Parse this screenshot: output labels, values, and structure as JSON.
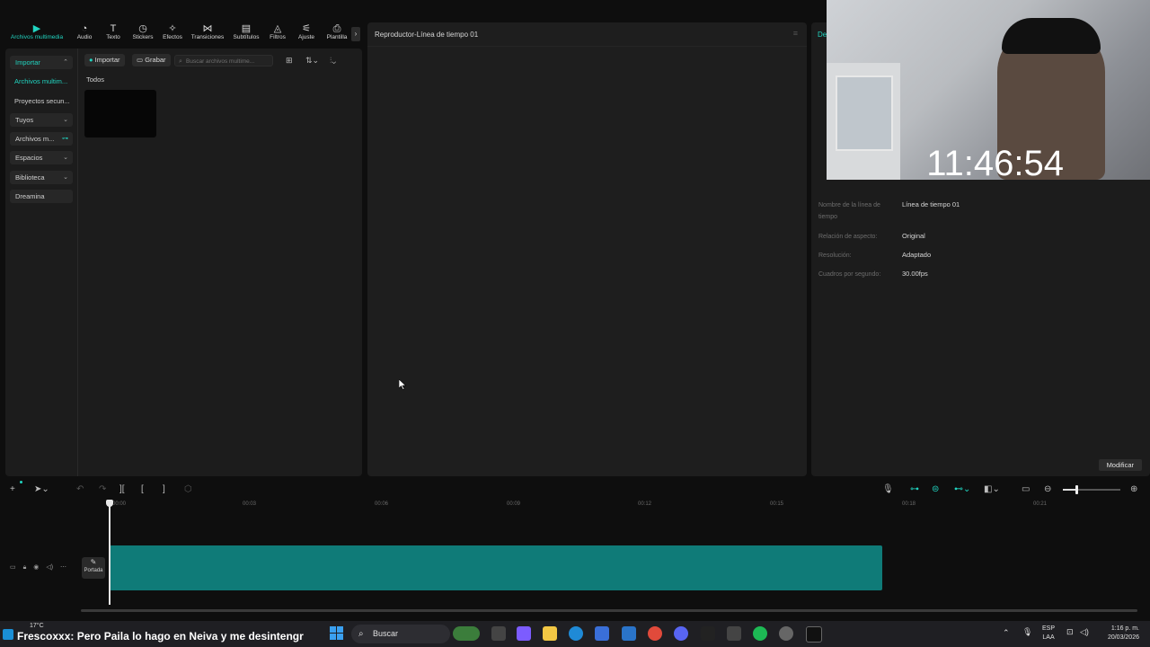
{
  "toolbar": {
    "items": [
      {
        "label": "Archivos multimedia",
        "icon": "media-icon",
        "active": true
      },
      {
        "label": "Audio",
        "icon": "audio-icon"
      },
      {
        "label": "Texto",
        "icon": "text-icon"
      },
      {
        "label": "Stickers",
        "icon": "stickers-icon"
      },
      {
        "label": "Efectos",
        "icon": "effects-icon"
      },
      {
        "label": "Transiciones",
        "icon": "transitions-icon"
      },
      {
        "label": "Subtítulos",
        "icon": "subtitles-icon"
      },
      {
        "label": "Filtros",
        "icon": "filters-icon"
      },
      {
        "label": "Ajuste",
        "icon": "adjust-icon"
      },
      {
        "label": "Plantilla",
        "icon": "template-icon"
      }
    ]
  },
  "sidebar": {
    "items": [
      {
        "label": "Importar",
        "active": true
      },
      {
        "label": "Archivos multim...",
        "active": true
      },
      {
        "label": "Proyectos secun..."
      },
      {
        "label": "Tuyos"
      },
      {
        "label": "Archivos m..."
      },
      {
        "label": "Espacios"
      },
      {
        "label": "Biblioteca"
      },
      {
        "label": "Dreamina"
      }
    ]
  },
  "media": {
    "import_label": "Importar",
    "record_label": "Grabar",
    "search_placeholder": "Buscar archivos multime...",
    "filter_label": "Todos"
  },
  "player": {
    "title": "Reproductor-Línea de tiempo 01"
  },
  "details": {
    "header": "De",
    "rows": [
      {
        "label": "Nombre de la línea de tiempo",
        "value": "Línea de tiempo 01"
      },
      {
        "label": "Relación de aspecto:",
        "value": "Original"
      },
      {
        "label": "Resolución:",
        "value": "Adaptado"
      },
      {
        "label": "Cuadros por segundo:",
        "value": "30.00fps"
      }
    ],
    "modify_label": "Modificar"
  },
  "webcam": {
    "clock": "11:46:54"
  },
  "timeline": {
    "ticks": [
      "00:00",
      "00:03",
      "00:06",
      "00:09",
      "00:12",
      "00:15",
      "00:18",
      "00:21"
    ],
    "cover_label": "Portada"
  },
  "taskbar": {
    "weather": "17°C",
    "ticker_user": "Frescoxxx",
    "ticker_message": ": Pero Paila lo hago en Neiva y me desintengr",
    "search_label": "Buscar",
    "lang_top": "ESP",
    "lang_bottom": "LAA",
    "time": "1:16 p. m.",
    "date": "20/03/2026"
  },
  "colors": {
    "accent": "#21d4c0",
    "clip": "#0f7b78",
    "panel": "#1e1e1e",
    "background": "#0e0e0e"
  }
}
